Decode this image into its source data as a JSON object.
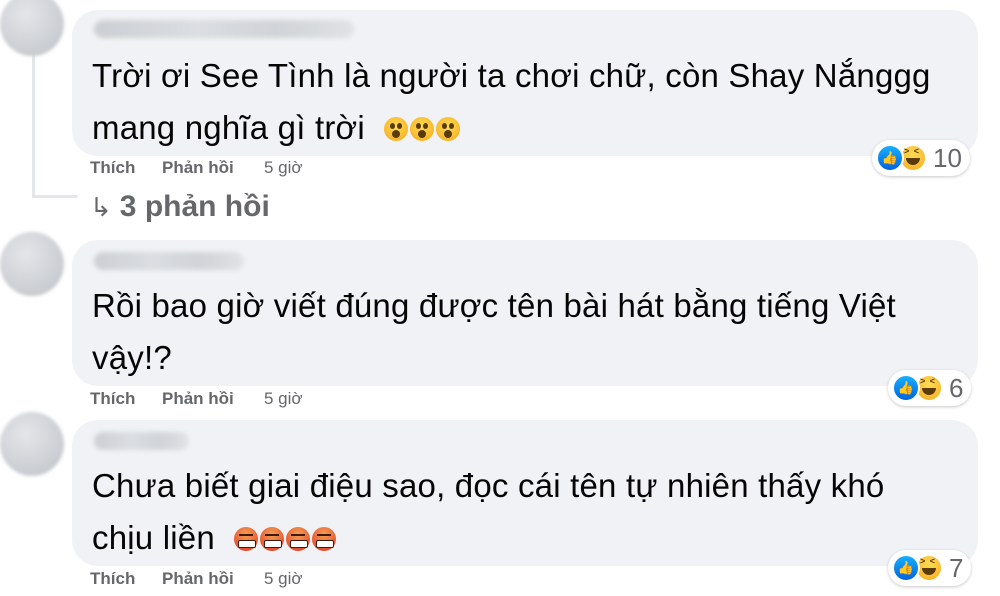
{
  "comments": [
    {
      "lines": [
        "Trời ơi See Tình là người ta chơi chữ, còn Shay Nắnggg",
        "mang nghĩa gì trời"
      ],
      "emoji": [
        "wow-emoji",
        "wow-emoji",
        "wow-emoji"
      ],
      "actions": {
        "like": "Thích",
        "reply": "Phản hồi",
        "time": "5 giờ"
      },
      "reaction_count": "10",
      "reaction_icons": [
        "like-icon",
        "haha-icon"
      ]
    },
    {
      "lines": [
        "Rồi bao giờ viết đúng được tên bài hát bằng tiếng Việt",
        "vậy!?"
      ],
      "emoji": [],
      "actions": {
        "like": "Thích",
        "reply": "Phản hồi",
        "time": "5 giờ"
      },
      "reaction_count": "6",
      "reaction_icons": [
        "like-icon",
        "haha-icon"
      ]
    },
    {
      "lines": [
        "Chưa biết giai điệu sao, đọc cái tên tự nhiên thấy khó",
        "chịu liền"
      ],
      "emoji": [
        "angry-emoji",
        "angry-emoji",
        "angry-emoji",
        "angry-emoji"
      ],
      "actions": {
        "like": "Thích",
        "reply": "Phản hồi",
        "time": "5 giờ"
      },
      "reaction_count": "7",
      "reaction_icons": [
        "like-icon",
        "haha-icon"
      ]
    }
  ],
  "replies_link": {
    "arrow": "↳",
    "label": "3 phản hồi"
  },
  "colors": {
    "bubble": "#f0f2f5",
    "secondary_text": "#65676b",
    "like_blue": "#1877f2",
    "emoji_yellow": "#f7b125",
    "angry_red": "#e0452c"
  }
}
